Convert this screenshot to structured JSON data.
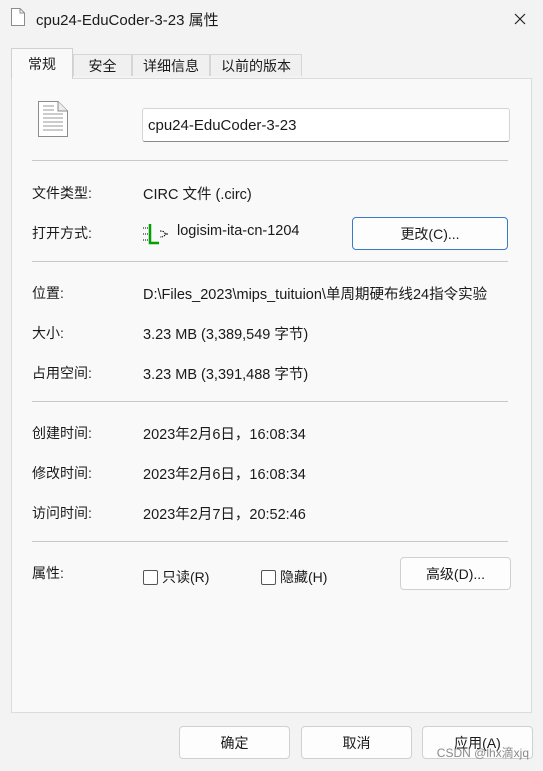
{
  "window": {
    "title": "cpu24-EduCoder-3-23 属性"
  },
  "tabs": [
    {
      "label": "常规"
    },
    {
      "label": "安全"
    },
    {
      "label": "详细信息"
    },
    {
      "label": "以前的版本"
    }
  ],
  "general": {
    "file_name": "cpu24-EduCoder-3-23",
    "file_type_label": "文件类型:",
    "file_type_value": "CIRC 文件 (.circ)",
    "open_with_label": "打开方式:",
    "open_with_app": "logisim-ita-cn-1204",
    "change_button": "更改(C)...",
    "location_label": "位置:",
    "location_value": "D:\\Files_2023\\mips_tuituion\\单周期硬布线24指令实验",
    "size_label": "大小:",
    "size_value": "3.23 MB (3,389,549 字节)",
    "size_on_disk_label": "占用空间:",
    "size_on_disk_value": "3.23 MB (3,391,488 字节)",
    "created_label": "创建时间:",
    "created_value": "2023年2月6日，16:08:34",
    "modified_label": "修改时间:",
    "modified_value": "2023年2月6日，16:08:34",
    "accessed_label": "访问时间:",
    "accessed_value": "2023年2月7日，20:52:46",
    "attributes_label": "属性:",
    "readonly_label": "只读(R)",
    "readonly_checked": false,
    "hidden_label": "隐藏(H)",
    "hidden_checked": false,
    "advanced_button": "高级(D)..."
  },
  "footer": {
    "ok_button": "确定",
    "cancel_button": "取消",
    "apply_button": "应用(A)"
  },
  "watermark": "CSDN @lhx滴xjq",
  "colors": {
    "accent": "#3a7bc8",
    "app_icon": "#00a000"
  }
}
